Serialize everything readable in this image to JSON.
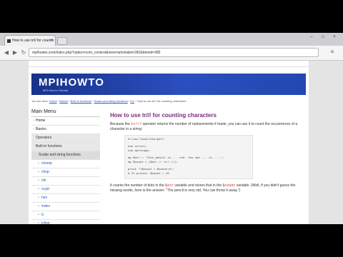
{
  "browser": {
    "tab_title": "How to use tr/// for countin",
    "tab_close": "×",
    "new_tab": "",
    "win_min": "–",
    "win_max": "□",
    "win_close": "×",
    "back": "◀",
    "forward": "▶",
    "reload": "↻",
    "url": "mpihowto.com/index.php?option=com_content&view=article&id=282&Itemid=385",
    "menu": "≡"
  },
  "site": {
    "logo": "MPIHOWTO",
    "tagline": "MPI How to Tutorial",
    "breadcrumb_prefix": "You are here:",
    "breadcrumb": [
      "Home",
      "Basics",
      "Built-in functions",
      "Scalar and string functions",
      "tr///",
      "How to use tr/// for counting characters"
    ],
    "breadcrumb_sep": "›"
  },
  "sidebar": {
    "title": "Main Menu",
    "items": [
      {
        "label": "Home",
        "level": 1
      },
      {
        "label": "Basics",
        "level": 1
      },
      {
        "label": "Operators",
        "level": 2
      },
      {
        "label": "Built-in functions",
        "level": 2
      },
      {
        "label": "Scalar and string functions",
        "level": 3
      },
      {
        "label": "chomp",
        "level": 4
      },
      {
        "label": "chop",
        "level": 4
      },
      {
        "label": "chr",
        "level": 4
      },
      {
        "label": "crypt",
        "level": 4
      },
      {
        "label": "hex",
        "level": 4
      },
      {
        "label": "index",
        "level": 4
      },
      {
        "label": "lc",
        "level": 4
      },
      {
        "label": "lcfirst",
        "level": 4
      },
      {
        "label": "length",
        "level": 4
      }
    ]
  },
  "article": {
    "title": "How to use tr/// for counting characters",
    "intro_a": "Because the ",
    "intro_code": "tr///",
    "intro_b": " operator returns the number of replacements if made, you can use it to count the occurrences of a character in a string:",
    "code_lines": [
      "#!/usr/local/bin/perl",
      "",
      "use strict;",
      "use warnings;",
      "",
      "my $str = 'This pencil is ... red. You can ... it.....';",
      "my $count = ($str =~ tr/.//);",
      "",
      "print \"\\$count = $count\\n\";",
      "# It prints: $count = 10"
    ],
    "outro_a": "It counts the number of dots in the ",
    "outro_code1": "$str",
    "outro_b": " variable and stores that in the ",
    "outro_code2": "$count",
    "outro_c": " variable. (Well, if you didn't guess the missing words, here is the answer: \"The pencil is very old. You can throw it away.\")"
  }
}
